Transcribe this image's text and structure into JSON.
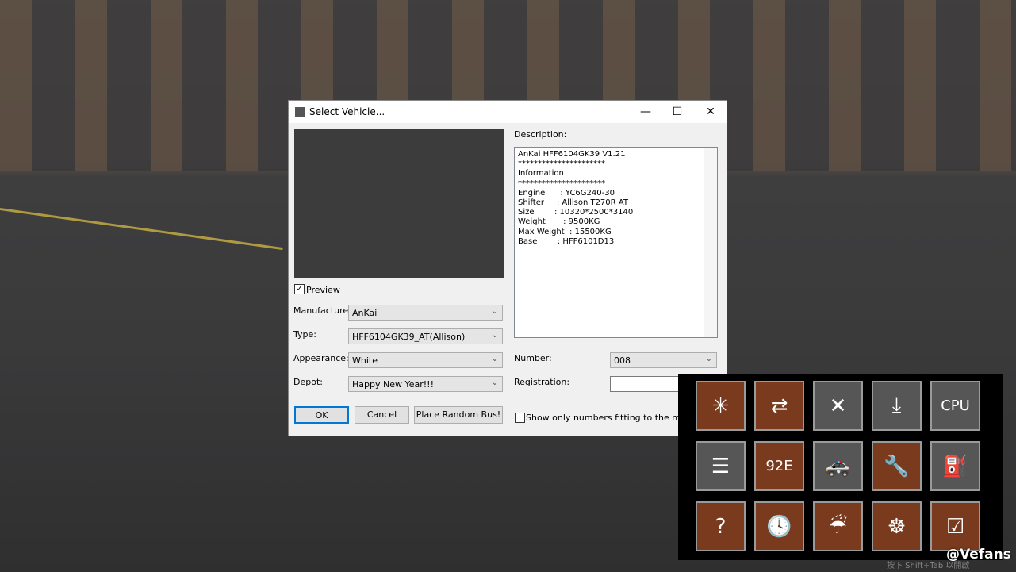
{
  "dialog": {
    "title": "Select Vehicle...",
    "minimize": "—",
    "maximize": "☐",
    "close": "✕",
    "preview_label": "Preview",
    "preview_checked": true,
    "manufacturer_label": "Manufacturer:",
    "manufacturer": "AnKai",
    "type_label": "Type:",
    "type": "HFF6104GK39_AT(Allison)",
    "appearance_label": "Appearance:",
    "appearance": "White",
    "depot_label": "Depot:",
    "depot": "Happy New Year!!!",
    "ok": "OK",
    "cancel": "Cancel",
    "random": "Place Random Bus!",
    "description_label": "Description:",
    "description": "AnKai HFF6104GK39 V1.21\n**********************\nInformation\n**********************\nEngine      : YC6G240-30\nShifter     : Allison T270R AT\nSize        : 10320*2500*3140\nWeight       : 9500KG\nMax Weight  : 15500KG\nBase        : HFF6101D13",
    "number_label": "Number:",
    "number": "008",
    "registration_label": "Registration:",
    "registration": "",
    "show_only_label": "Show only numbers fitting to the map's depot",
    "show_only_checked": false
  },
  "toolbar": {
    "tiles": [
      {
        "icon": "bus-accident-icon",
        "glyph": "✳",
        "color": "brown"
      },
      {
        "icon": "bus-switch-icon",
        "glyph": "⇄",
        "color": "brown"
      },
      {
        "icon": "bus-remove-icon",
        "glyph": "✕",
        "color": "gray"
      },
      {
        "icon": "bus-unhitch-icon",
        "glyph": "⤓",
        "color": "gray"
      },
      {
        "icon": "bus-cpu-icon",
        "glyph": "CPU",
        "color": "gray"
      },
      {
        "icon": "ticket-printer-icon",
        "glyph": "☰",
        "color": "gray"
      },
      {
        "icon": "route-display-icon",
        "glyph": "92E",
        "color": "brown"
      },
      {
        "icon": "police-car-icon",
        "glyph": "🚓",
        "color": "gray"
      },
      {
        "icon": "repair-tools-icon",
        "glyph": "🔧",
        "color": "brown"
      },
      {
        "icon": "refuel-icon",
        "glyph": "⛽",
        "color": "gray"
      },
      {
        "icon": "help-sign-icon",
        "glyph": "?",
        "color": "brown"
      },
      {
        "icon": "clock-icon",
        "glyph": "🕓",
        "color": "brown"
      },
      {
        "icon": "weather-icon",
        "glyph": "☔",
        "color": "brown"
      },
      {
        "icon": "steering-wheel-icon",
        "glyph": "☸",
        "color": "brown"
      },
      {
        "icon": "checklist-person-icon",
        "glyph": "☑",
        "color": "brown"
      }
    ],
    "hint": "按下 Shift+Tab 以開啟"
  },
  "watermark": "@Vefans",
  "colors": {
    "brown": "#7a3a1e",
    "gray": "#565656"
  }
}
